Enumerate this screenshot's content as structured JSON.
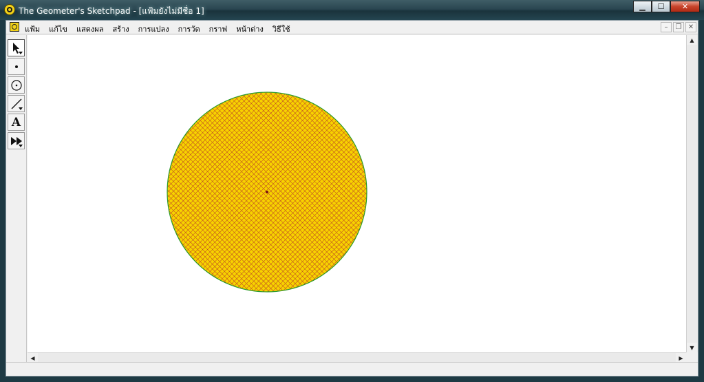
{
  "window": {
    "title": "The Geometer's Sketchpad - [แฟ้มยังไม่มีชื่อ 1]",
    "buttons": {
      "minimize": "▁",
      "maximize": "☐",
      "close": "✕"
    }
  },
  "menu": {
    "items": [
      {
        "label": "แฟ้ม"
      },
      {
        "label": "แก้ไข"
      },
      {
        "label": "แสดงผล"
      },
      {
        "label": "สร้าง"
      },
      {
        "label": "การแปลง"
      },
      {
        "label": "การวัด"
      },
      {
        "label": "กราฟ"
      },
      {
        "label": "หน้าต่าง"
      },
      {
        "label": "วิธีใช้"
      }
    ],
    "mdi_buttons": {
      "minimize": "–",
      "restore": "❐",
      "close": "✕"
    }
  },
  "toolbox": {
    "tools": [
      {
        "name": "arrow-tool",
        "icon": "arrow-icon",
        "active": true
      },
      {
        "name": "point-tool",
        "icon": "point-icon",
        "active": false
      },
      {
        "name": "compass-tool",
        "icon": "compass-icon",
        "active": false
      },
      {
        "name": "straightedge-tool",
        "icon": "straightedge-icon",
        "active": false
      },
      {
        "name": "text-tool",
        "icon": "text-icon",
        "label": "A",
        "active": false
      },
      {
        "name": "custom-tool",
        "icon": "custom-tool-icon",
        "active": false
      }
    ]
  },
  "sketch": {
    "circle": {
      "fill_color": "#f7d200",
      "hatch_color": "#b02a2a",
      "stroke_color": "#2a9a2a",
      "center_color": "#7a1010"
    }
  },
  "scrollbars": {
    "up_arrow": "▲",
    "down_arrow": "▼",
    "left_arrow": "◀",
    "right_arrow": "▶"
  }
}
